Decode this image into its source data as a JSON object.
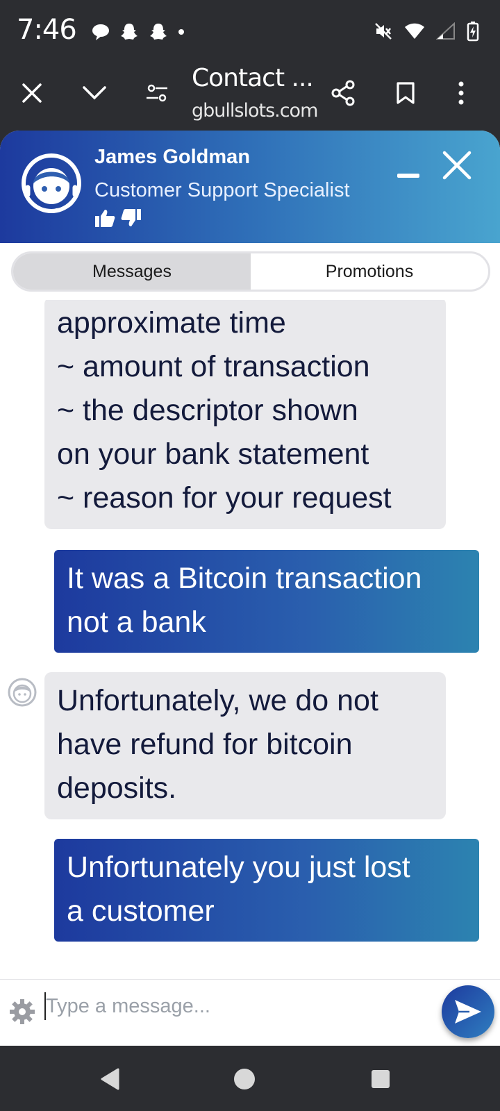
{
  "status_bar": {
    "time": "7:46",
    "icons": [
      "chat-notification-icon",
      "snapchat-icon",
      "snapchat-icon",
      "dot-icon",
      "mute-icon",
      "wifi-icon",
      "signal-icon",
      "battery-charging-icon"
    ]
  },
  "browser": {
    "title": "Contact ...",
    "url": "gbullslots.com",
    "buttons": [
      "close",
      "collapse",
      "page-settings",
      "share",
      "bookmark",
      "more"
    ]
  },
  "chat": {
    "agent_name": "James Goldman",
    "agent_role": "Customer Support Specialist",
    "tabs": [
      {
        "label": "Messages",
        "active": true
      },
      {
        "label": "Promotions",
        "active": false
      }
    ],
    "messages": [
      {
        "from": "agent",
        "lines": [
          "approximate time",
          "~ amount of transaction",
          "~ the descriptor shown",
          "on your bank statement",
          "~ reason for your request"
        ]
      },
      {
        "from": "user",
        "lines": [
          "It was a Bitcoin transaction",
          "not a bank"
        ]
      },
      {
        "from": "agent",
        "lines": [
          "Unfortunately, we do not",
          "have refund for bitcoin",
          "deposits."
        ]
      },
      {
        "from": "user",
        "lines": [
          "Unfortunately you just lost",
          "a customer"
        ]
      }
    ],
    "composer": {
      "placeholder": "Type a message...",
      "value": ""
    }
  },
  "colors": {
    "header_gradient_start": "#1d3a9e",
    "header_gradient_end": "#49a4cf",
    "agent_bubble": "#e9e9ec",
    "agent_text": "#131a3b",
    "system_bar": "#2c2d31"
  }
}
